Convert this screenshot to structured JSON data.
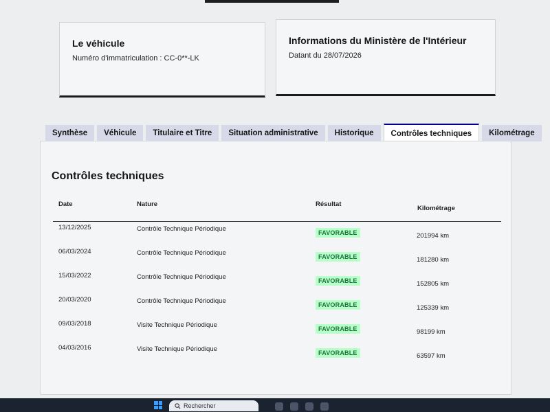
{
  "vehicle_card": {
    "title": "Le véhicule",
    "registration": "Numéro d'immatriculation : CC-0**-LK"
  },
  "ministry_card": {
    "title": "Informations du Ministère de l'Intérieur",
    "date": "Datant du 28/07/2026"
  },
  "tabs": [
    {
      "label": "Synthèse",
      "active": false
    },
    {
      "label": "Véhicule",
      "active": false
    },
    {
      "label": "Titulaire et Titre",
      "active": false
    },
    {
      "label": "Situation administrative",
      "active": false
    },
    {
      "label": "Historique",
      "active": false
    },
    {
      "label": "Contrôles techniques",
      "active": true
    },
    {
      "label": "Kilométrage",
      "active": false
    }
  ],
  "section": {
    "title": "Contrôles techniques",
    "columns": {
      "date": "Date",
      "nature": "Nature",
      "result": "Résultat",
      "mileage": "Kilométrage"
    },
    "rows": [
      {
        "date": "13/12/2025",
        "nature": "Contrôle Technique Périodique",
        "result": "FAVORABLE",
        "km": "201994 km"
      },
      {
        "date": "06/03/2024",
        "nature": "Contrôle Technique Périodique",
        "result": "FAVORABLE",
        "km": "181280 km"
      },
      {
        "date": "15/03/2022",
        "nature": "Contrôle Technique Périodique",
        "result": "FAVORABLE",
        "km": "152805 km"
      },
      {
        "date": "20/03/2020",
        "nature": "Contrôle Technique Périodique",
        "result": "FAVORABLE",
        "km": "125339 km"
      },
      {
        "date": "09/03/2018",
        "nature": "Visite Technique Périodique",
        "result": "FAVORABLE",
        "km": "98199 km"
      },
      {
        "date": "04/03/2016",
        "nature": "Visite Technique Périodique",
        "result": "FAVORABLE",
        "km": "63597 km"
      }
    ]
  },
  "taskbar": {
    "search_placeholder": "Rechercher",
    "start_icon": "windows-icon",
    "search_icon": "search-icon"
  },
  "colors": {
    "accent": "#000091",
    "tab_bg": "#d7d9e8",
    "badge_bg": "#b8fec9",
    "badge_text": "#18753c"
  }
}
